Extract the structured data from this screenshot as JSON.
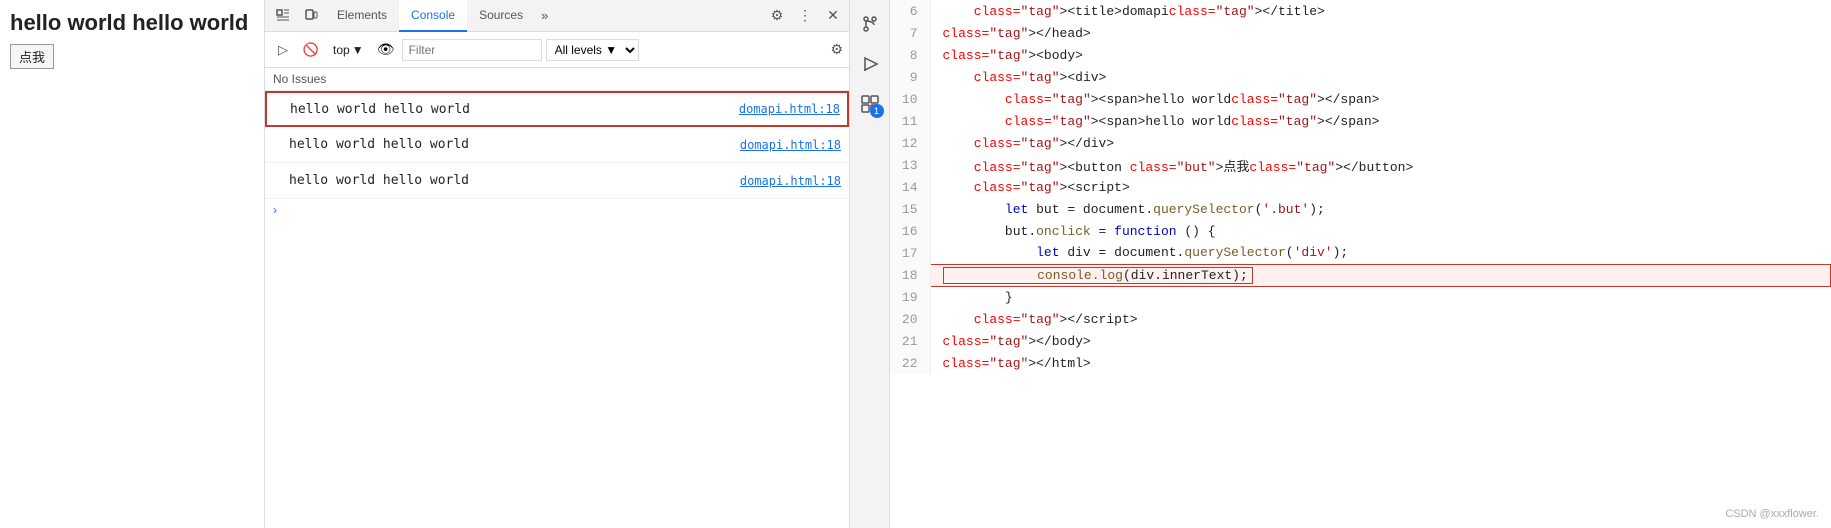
{
  "page": {
    "title": "hello world hello world",
    "button_label": "点我"
  },
  "devtools": {
    "tabs": [
      {
        "label": "Elements",
        "active": false
      },
      {
        "label": "Console",
        "active": true
      },
      {
        "label": "Sources",
        "active": false
      }
    ],
    "more_label": "»",
    "toolbar": {
      "context": "top",
      "filter_placeholder": "Filter",
      "level_label": "All levels ▼"
    },
    "no_issues": "No Issues",
    "messages": [
      {
        "text": "hello world hello world",
        "link": "domapi.html:18",
        "highlighted": true
      },
      {
        "text": "hello world hello world",
        "link": "domapi.html:18",
        "highlighted": false
      },
      {
        "text": "hello world hello world",
        "link": "domapi.html:18",
        "highlighted": false
      }
    ],
    "expand_symbol": "›"
  },
  "sources": {
    "sidebar_icons": [
      "git-icon",
      "play-icon",
      "structure-icon"
    ],
    "badge_count": "1",
    "code": {
      "lines": [
        {
          "num": 6,
          "content": "    <title>domapi</title>",
          "highlight": false
        },
        {
          "num": 7,
          "content": "</head>",
          "highlight": false
        },
        {
          "num": 8,
          "content": "<body>",
          "highlight": false
        },
        {
          "num": 9,
          "content": "    <div>",
          "highlight": false
        },
        {
          "num": 10,
          "content": "        <span>hello world</span>",
          "highlight": false
        },
        {
          "num": 11,
          "content": "        <span>hello world</span>",
          "highlight": false
        },
        {
          "num": 12,
          "content": "    </div>",
          "highlight": false
        },
        {
          "num": 13,
          "content": "    <button class=\"but\">点我</button>",
          "highlight": false
        },
        {
          "num": 14,
          "content": "    <script>",
          "highlight": false
        },
        {
          "num": 15,
          "content": "        let but = document.querySelector('.but');",
          "highlight": false
        },
        {
          "num": 16,
          "content": "        but.onclick = function () {",
          "highlight": false
        },
        {
          "num": 17,
          "content": "            let div = document.querySelector('div');",
          "highlight": false
        },
        {
          "num": 18,
          "content": "            console.log(div.innerText);",
          "highlight": true
        },
        {
          "num": 19,
          "content": "        }",
          "highlight": false
        },
        {
          "num": 20,
          "content": "    </script>",
          "highlight": false
        },
        {
          "num": 21,
          "content": "</body>",
          "highlight": false
        },
        {
          "num": 22,
          "content": "</html>",
          "highlight": false
        }
      ]
    }
  },
  "watermark": "CSDN @xxxflower."
}
